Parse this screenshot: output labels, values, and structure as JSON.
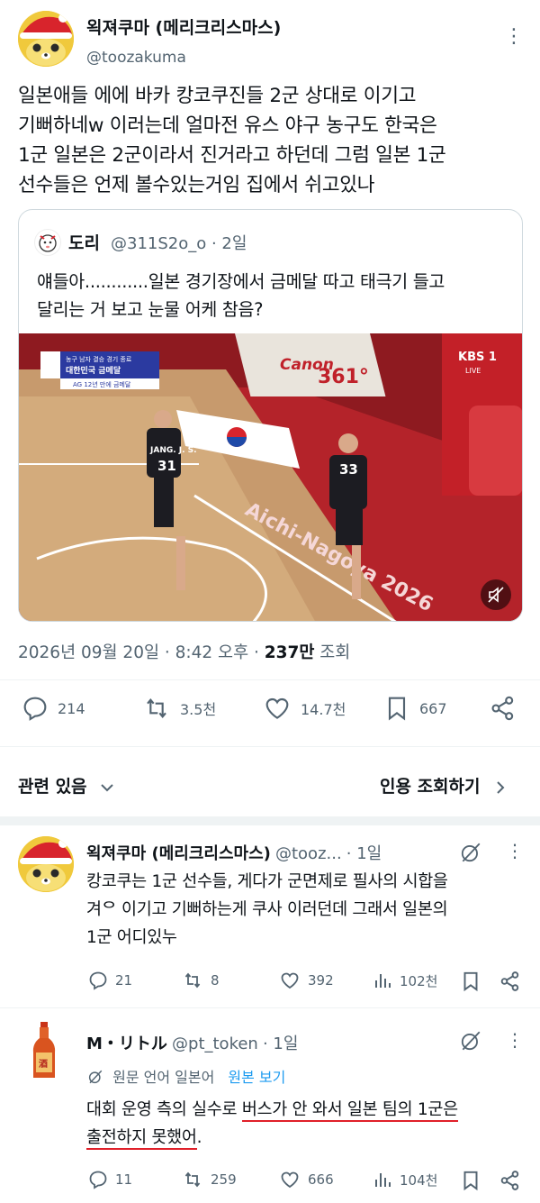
{
  "main_tweet": {
    "author_name": "왹져쿠마 (메리크리스마스)",
    "handle": "@toozakuma",
    "more_icon": "⋮",
    "text_lines": [
      "일본애들 에에 바카 캉코쿠진들 2군 상대로 이기고",
      "기뻐하네w 이러는데 얼마전 유스 야구 농구도 한국은",
      "1군 일본은 2군이라서 진거라고 하던데 그럼 일본 1군",
      "선수들은 언제 볼수있는거임 집에서 쉬고있나"
    ],
    "quote": {
      "name": "도리",
      "handle_time": "@311S2o_o · 2일",
      "text_lines": [
        "얘들아............일본 경기장에서 금메달 따고 태극기 들고",
        "달리는 거 보고 눈물 어케 참음?"
      ],
      "media": {
        "scoreboard_line1": "농구 남자 결승 경기 종료",
        "scoreboard_line2": "대한민국 금메달",
        "scoreboard_line3": "AG 12년 만에 금메달",
        "banner1": "Canon",
        "banner2": "361°",
        "court_text": "Aichi-Nagoya 2026",
        "broadcaster": "KBS 1",
        "broadcaster_sub": "LIVE",
        "player1_name": "JANG. J. S.",
        "player1_number": "31",
        "player2_number": "33",
        "mute_icon": "speaker-muted-icon"
      }
    },
    "meta": {
      "date_time": "2026년 09월 20일 · 8:42 오후 · ",
      "views_count": "237만",
      "views_label": " 조회"
    },
    "actions": {
      "replies": "214",
      "retweets": "3.5천",
      "likes": "14.7천",
      "bookmarks": "667"
    }
  },
  "related": {
    "label": "관련 있음",
    "quote_views_label": "인용 조회하기"
  },
  "replies": [
    {
      "author_name": "왹져쿠마 (메리크리스마스)",
      "handle": "@tooz...",
      "time": "· 1일",
      "text_lines": [
        "캉코쿠는 1군 선수들, 게다가 군면제로 필사의 시합을",
        "겨ᄋ 이기고 기뻐하는게 쿠사 이러던데 그래서 일본의",
        "1군 어디있누"
      ],
      "actions": {
        "replies": "21",
        "retweets": "8",
        "likes": "392",
        "views": "102천"
      }
    },
    {
      "author_name": "M・リトル",
      "handle": "@pt_token",
      "time": "· 1일",
      "translation_note": "원문 언어 일본어",
      "translation_link": "원본 보기",
      "text_line1_plain": "대회 운영 측의 실수로 ",
      "text_line1_underlined": "버스가 안 와서 일본 팀의 1군은",
      "text_line2_underlined": "출전하지 못했어",
      "text_line2_end": ".",
      "actions": {
        "replies": "11",
        "retweets": "259",
        "likes": "666",
        "views": "104천"
      }
    }
  ],
  "colors": {
    "text": "#0f1419",
    "muted": "#536471",
    "link": "#1d9bf0",
    "border": "#cfd9de",
    "underline": "#e0202a"
  }
}
